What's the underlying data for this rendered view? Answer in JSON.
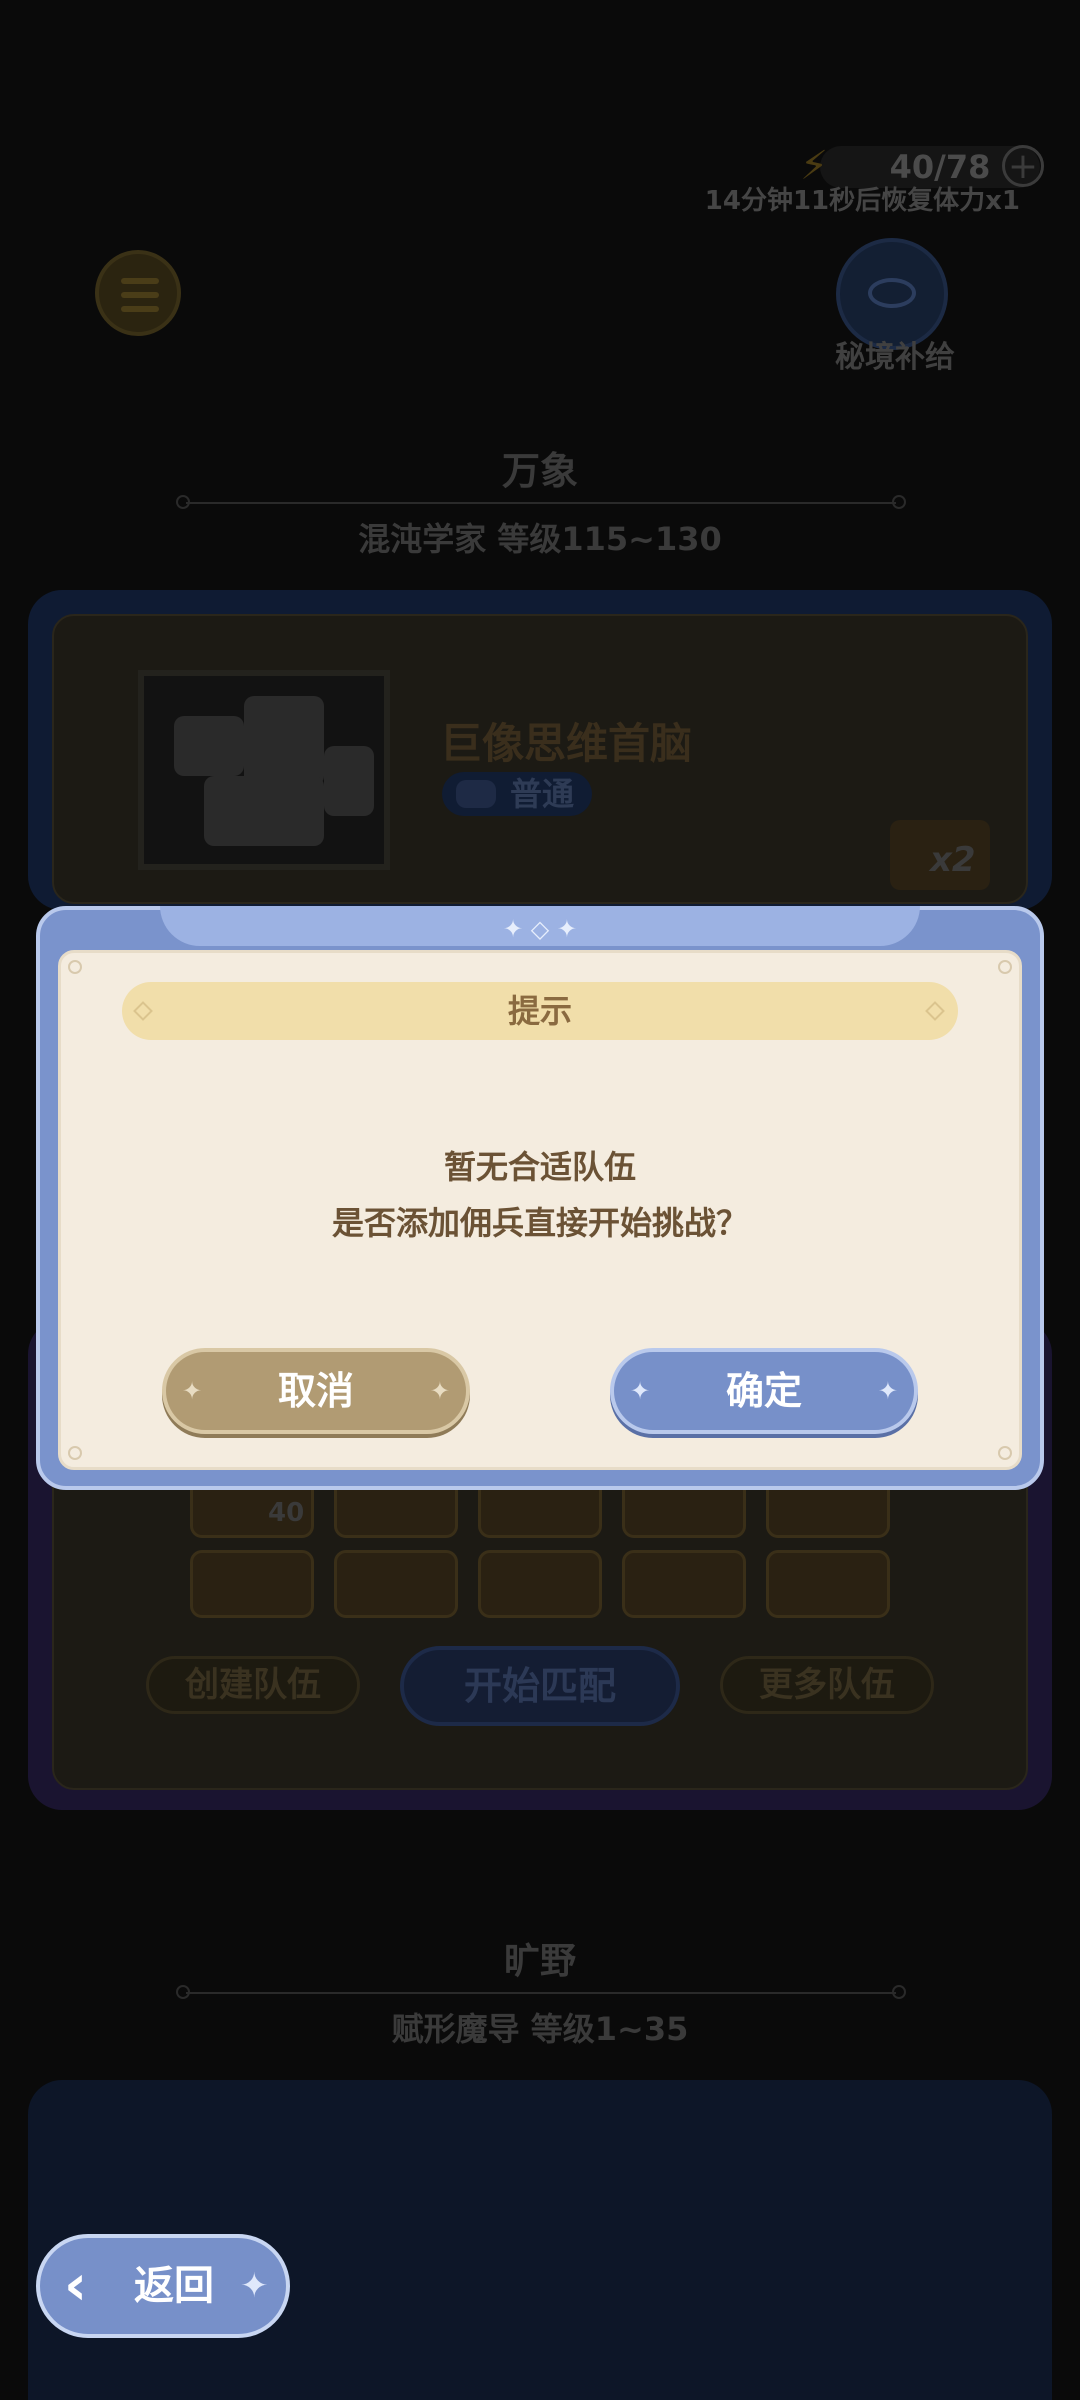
{
  "header": {
    "energy": "40/78",
    "energy_plus": "+",
    "recover_text": "14分钟11秒后恢复体力x1",
    "supply_label": "秘境补给"
  },
  "sections": [
    {
      "title": "万象",
      "subtitle": "混沌学家  等级115~130"
    },
    {
      "title": "旷野",
      "subtitle": "赋形魔导  等级1~35"
    }
  ],
  "boss": {
    "name": "巨像思维首脑",
    "difficulty": "普通",
    "reward_multiplier": "x2"
  },
  "team": {
    "slot_value": "40",
    "create_team": "创建队伍",
    "start_match": "开始匹配",
    "more_teams": "更多队伍"
  },
  "dialog": {
    "title": "提示",
    "message_line1": "暂无合适队伍",
    "message_line2": "是否添加佣兵直接开始挑战？",
    "cancel": "取消",
    "confirm": "确定"
  },
  "footer": {
    "return_label": "返回"
  },
  "colors": {
    "dialog_frame": "#7a93cc",
    "dialog_body": "#f4ecdf",
    "title_bar": "#f1deaa",
    "cancel_button": "#b19b73",
    "confirm_button": "#7790c9",
    "text_brown": "#6b5235"
  }
}
